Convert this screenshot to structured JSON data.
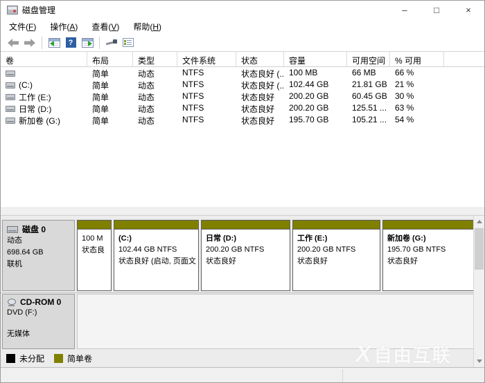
{
  "window": {
    "title": "磁盘管理",
    "controls": {
      "minimize": "–",
      "maximize": "□",
      "close": "×"
    }
  },
  "menu": {
    "file": {
      "pre": "文件(",
      "key": "F",
      "post": ")"
    },
    "action": {
      "pre": "操作(",
      "key": "A",
      "post": ")"
    },
    "view": {
      "pre": "查看(",
      "key": "V",
      "post": ")"
    },
    "help": {
      "pre": "帮助(",
      "key": "H",
      "post": ")"
    }
  },
  "toolbar": {
    "icons": [
      "back-icon",
      "forward-icon",
      "show-tree-icon",
      "help-icon",
      "show-actions-icon",
      "action-tool-icon",
      "properties-icon"
    ],
    "help_glyph": "?"
  },
  "volume_table": {
    "columns": [
      "卷",
      "布局",
      "类型",
      "文件系统",
      "状态",
      "容量",
      "可用空间",
      "% 可用"
    ],
    "rows": [
      {
        "name": "",
        "layout": "简单",
        "type": "动态",
        "fs": "NTFS",
        "status": "状态良好 (...",
        "capacity": "100 MB",
        "free": "66 MB",
        "pct": "66 %"
      },
      {
        "name": "(C:)",
        "layout": "简单",
        "type": "动态",
        "fs": "NTFS",
        "status": "状态良好 (...",
        "capacity": "102.44 GB",
        "free": "21.81 GB",
        "pct": "21 %"
      },
      {
        "name": "工作 (E:)",
        "layout": "简单",
        "type": "动态",
        "fs": "NTFS",
        "status": "状态良好",
        "capacity": "200.20 GB",
        "free": "60.45 GB",
        "pct": "30 %"
      },
      {
        "name": "日常 (D:)",
        "layout": "简单",
        "type": "动态",
        "fs": "NTFS",
        "status": "状态良好",
        "capacity": "200.20 GB",
        "free": "125.51 ...",
        "pct": "63 %"
      },
      {
        "name": "新加卷 (G:)",
        "layout": "简单",
        "type": "动态",
        "fs": "NTFS",
        "status": "状态良好",
        "capacity": "195.70 GB",
        "free": "105.21 ...",
        "pct": "54 %"
      }
    ]
  },
  "graph": {
    "disk0": {
      "title": "磁盘 0",
      "type": "动态",
      "size": "698.64 GB",
      "status": "联机",
      "partitions": [
        {
          "name": "",
          "size": "100 M",
          "status": "状态良"
        },
        {
          "name": "(C:)",
          "size": "102.44 GB NTFS",
          "status": "状态良好 (启动, 页面文"
        },
        {
          "name": "日常  (D:)",
          "size": "200.20 GB NTFS",
          "status": "状态良好"
        },
        {
          "name": "工作  (E:)",
          "size": "200.20 GB NTFS",
          "status": "状态良好"
        },
        {
          "name": "新加卷  (G:)",
          "size": "195.70 GB NTFS",
          "status": "状态良好"
        }
      ]
    },
    "cdrom": {
      "title": "CD-ROM 0",
      "drive": "DVD (F:)",
      "status": "无媒体"
    }
  },
  "legend": {
    "unallocated": {
      "label": "未分配",
      "color": "#000000"
    },
    "simple": {
      "label": "简单卷",
      "color": "#808000"
    }
  },
  "colors": {
    "simple_volume_band": "#808000",
    "unallocated": "#000000"
  },
  "watermark": {
    "logo": "X",
    "text": "自由互联"
  }
}
